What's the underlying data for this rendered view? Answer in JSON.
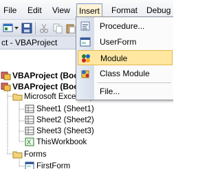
{
  "menubar": {
    "items": [
      {
        "label": "File",
        "accel": "F"
      },
      {
        "label": "Edit",
        "accel": "E"
      },
      {
        "label": "View",
        "accel": "V"
      },
      {
        "label": "Insert",
        "accel": "I"
      },
      {
        "label": "Format",
        "accel": "o"
      },
      {
        "label": "Debug",
        "accel": "D"
      }
    ]
  },
  "project_panel": {
    "title": "ct - VBAProject"
  },
  "tree": {
    "nodes": [
      {
        "label": "VBAProject (Book"
      },
      {
        "label": "VBAProject (Book"
      },
      {
        "label": "Microsoft Excel Objects"
      },
      {
        "label": "Sheet1 (Sheet1)"
      },
      {
        "label": "Sheet2 (Sheet2)"
      },
      {
        "label": "Sheet3 (Sheet3)"
      },
      {
        "label": "ThisWorkbook"
      },
      {
        "label": "Forms"
      },
      {
        "label": "FirstForm"
      }
    ]
  },
  "insert_menu": {
    "items": [
      {
        "label": "Procedure...",
        "icon": "procedure-icon"
      },
      {
        "label": "UserForm",
        "icon": "userform-icon"
      },
      {
        "label": "Module",
        "icon": "module-icon"
      },
      {
        "label": "Class Module",
        "icon": "class-module-icon"
      },
      {
        "label": "File...",
        "icon": ""
      }
    ]
  }
}
